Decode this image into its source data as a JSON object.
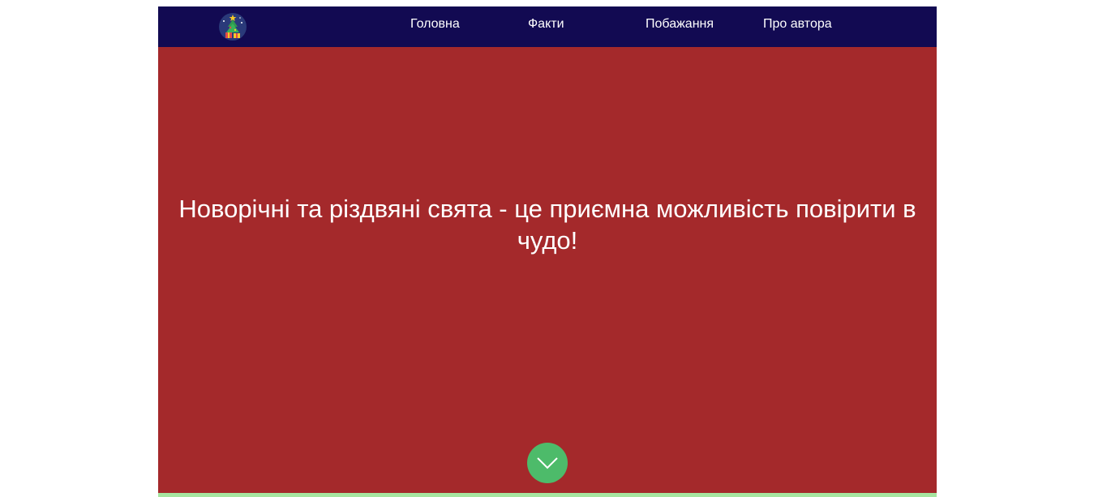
{
  "nav": {
    "logo_icon": "christmas-tree-icon",
    "links": [
      {
        "label": "Головна"
      },
      {
        "label": "Факти"
      },
      {
        "label": "Побажання"
      },
      {
        "label": "Про автора"
      }
    ]
  },
  "hero": {
    "heading": "Новорічні та різдвяні свята - це приємна можливість повірити в чудо!",
    "scroll_icon": "chevron-down-icon"
  },
  "colors": {
    "navbar": "#120a52",
    "hero_background": "#a4292b",
    "scroll_button": "#4dbb6a",
    "bottom_strip": "#a6e5a0",
    "text": "#ffffff"
  }
}
